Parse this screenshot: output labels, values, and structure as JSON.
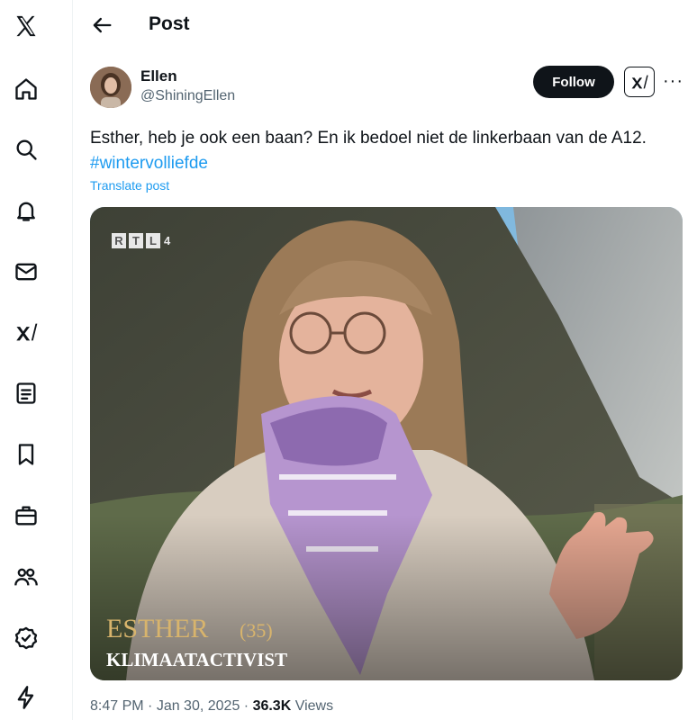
{
  "header": {
    "title": "Post",
    "back_icon": "back-arrow-icon"
  },
  "nav": {
    "icons": [
      "x-logo-icon",
      "home-icon",
      "search-icon",
      "bell-icon",
      "mail-icon",
      "grok-icon",
      "list-icon",
      "bookmark-icon",
      "briefcase-icon",
      "communities-icon",
      "verified-icon",
      "lightning-icon"
    ]
  },
  "author": {
    "name": "Ellen",
    "handle": "@ShiningEllen"
  },
  "actions": {
    "follow_label": "Follow",
    "more_label": "···"
  },
  "post": {
    "text": "Esther, heb je ook een baan? En ik bedoel niet de linkerbaan van de A12.",
    "hashtag": "#wintervolliefde",
    "translate_label": "Translate post"
  },
  "media": {
    "channel": "RTL",
    "channel_number": "4",
    "caption_name": "ESTHER",
    "caption_age": "(35)",
    "caption_role": "KLIMAATACTIVIST"
  },
  "meta": {
    "time": "8:47 PM",
    "sep1": " · ",
    "date": "Jan 30, 2025",
    "sep2": " · ",
    "views_count": "36.3K",
    "views_label": " Views"
  },
  "colors": {
    "accent": "#1d9bf0",
    "text": "#0f1419",
    "secondary": "#536471",
    "button": "#0f1419"
  }
}
